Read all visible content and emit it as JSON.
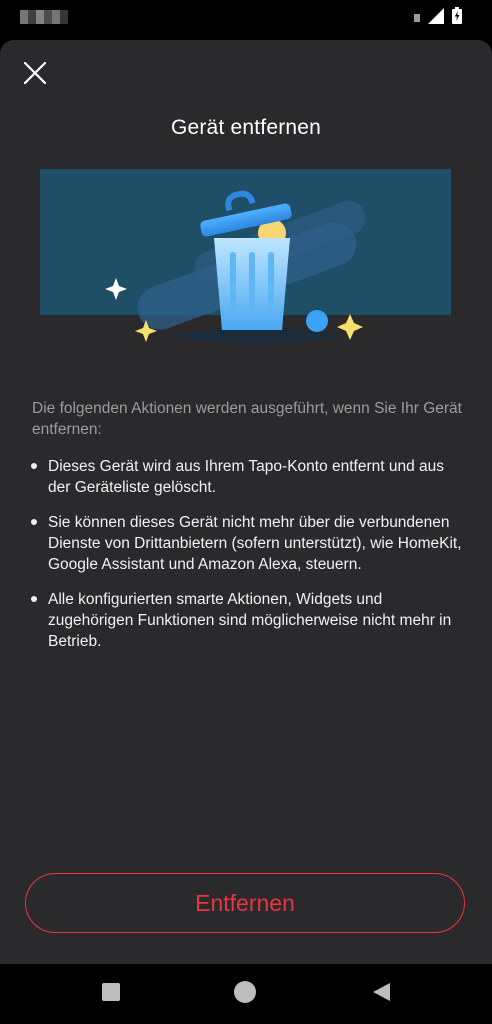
{
  "dialog": {
    "title": "Gerät entfernen",
    "intro": "Die folgenden Aktionen werden ausgeführt, wenn Sie Ihr Gerät entfernen:",
    "bullets": [
      "Dieses Gerät wird aus Ihrem Tapo-Konto entfernt und aus der Geräteliste gelöscht.",
      "Sie können dieses Gerät nicht mehr über die verbundenen Dienste von Drittanbietern (sofern unterstützt), wie HomeKit, Google Assistant und Amazon Alexa, steuern.",
      "Alle konfigurierten smarte Aktionen, Widgets und zugehörigen Funktionen sind möglicherweise nicht mehr in Betrieb."
    ],
    "remove_label": "Entfernen"
  },
  "icons": {
    "close": "close-icon",
    "illustration": "trash-can-illustration",
    "nav_home": "nav-home-icon",
    "nav_recents": "nav-recents-icon",
    "nav_back": "nav-back-icon"
  },
  "colors": {
    "sheet_background": "#2a2a2c",
    "accent_red": "#e8353f",
    "illustration_background": "#1f4f66",
    "illustration_blue": "#3aa3f5",
    "sparkle_yellow": "#f5e06b"
  }
}
